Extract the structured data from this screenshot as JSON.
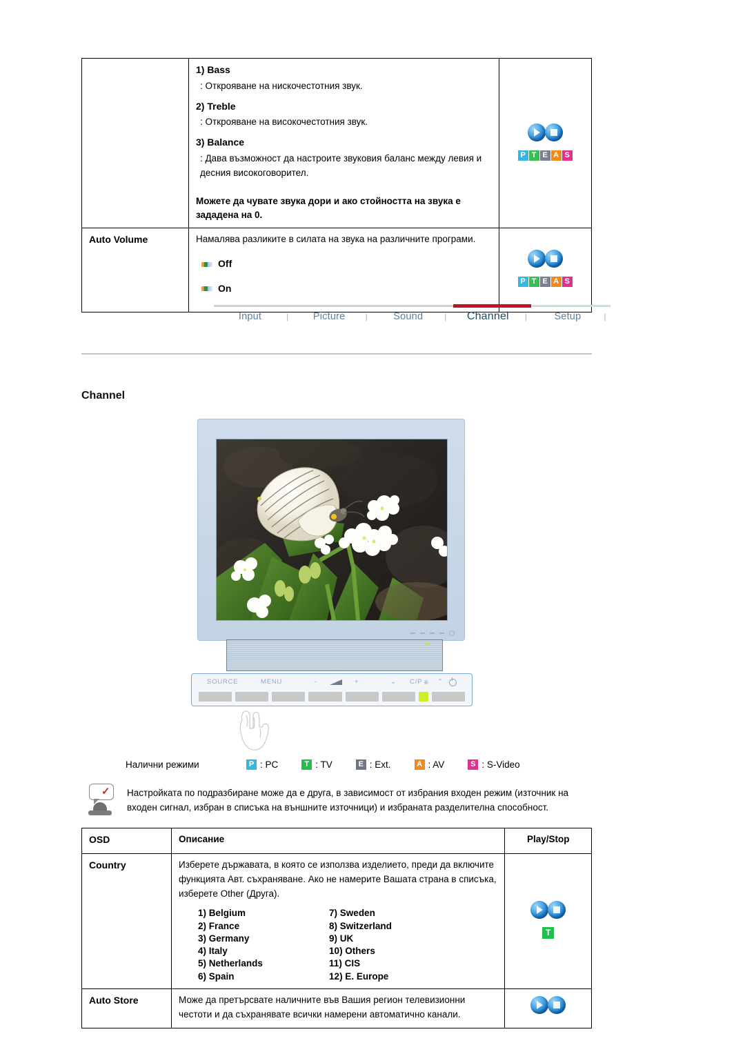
{
  "sound_table": {
    "rows": [
      {
        "osd": "",
        "items": [
          {
            "head": "1) Bass",
            "sub": ": Открояване на нискочестотния звук."
          },
          {
            "head": "2) Treble",
            "sub": ": Открояване на високочестотния звук."
          },
          {
            "head": "3) Balance",
            "sub": ": Дава възможност да настроите звуковия баланс между левия и десния високоговорител."
          }
        ],
        "note": "Можете да чувате звука дори и ако стойността на звука е зададена на 0.",
        "icon": "play-stop-pteas"
      },
      {
        "osd": "Auto Volume",
        "desc": "Намалява разликите в силата на звука на различните програми.",
        "options": [
          "Off",
          "On"
        ],
        "icon": "play-stop-pteas"
      }
    ]
  },
  "nav": {
    "tabs": [
      {
        "label": "Input",
        "active": false
      },
      {
        "label": "Picture",
        "active": false
      },
      {
        "label": "Sound",
        "active": false
      },
      {
        "label": "Channel",
        "active": true
      },
      {
        "label": "Setup",
        "active": false
      }
    ],
    "separator": "|",
    "active_bar_color": "#c01423"
  },
  "section": {
    "title": "Channel"
  },
  "monitor": {
    "buttons": [
      "SOURCE",
      "MENU",
      "-",
      "volume-icon",
      "+",
      "down-icon",
      "C/P",
      "up-icon",
      "power-icon"
    ],
    "screen_content": "butterfly-on-white-flowers-photo"
  },
  "modes": {
    "label": "Налични режими",
    "items": [
      {
        "badge": "P",
        "text": ": PC",
        "color": "#36b7e0"
      },
      {
        "badge": "T",
        "text": ": TV",
        "color": "#23bf4d"
      },
      {
        "badge": "E",
        "text": ": Ext.",
        "color": "#6e7585"
      },
      {
        "badge": "A",
        "text": ": AV",
        "color": "#f08a1c"
      },
      {
        "badge": "S",
        "text": ": S-Video",
        "color": "#e0318f"
      }
    ]
  },
  "note": {
    "text": "Настройката по подразбиране може да е друга, в зависимост от избрания входен режим (източник на входен сигнал, избран в списъка на външните източници) и избраната разделителна способност."
  },
  "channel_table": {
    "headers": [
      "OSD",
      "Описание",
      "Play/Stop"
    ],
    "rows": [
      {
        "osd": "Country",
        "desc": "Изберете държавата, в която се използва изделието, преди да включите функцията Авт. съхраняване. Ако не намерите Вашата страна в списъка, изберете Other (Друга).",
        "countries_left": [
          "1) Belgium",
          "2) France",
          "3) Germany",
          "4) Italy",
          "5) Netherlands",
          "6) Spain"
        ],
        "countries_right": [
          "7) Sweden",
          "8) Switzerland",
          "9) UK",
          "10) Others",
          "11) CIS",
          "12) E. Europe"
        ],
        "icon": "play-stop",
        "chip": "T"
      },
      {
        "osd": "Auto Store",
        "desc": "Може да претърсвате наличните във Вашия регион телевизионни честоти и да съхранявате всички намерени автоматично канали.",
        "icon": "play-stop"
      }
    ]
  },
  "pteas_badge": {
    "letters": [
      "P",
      "T",
      "E",
      "A",
      "S"
    ],
    "colors": [
      "#36b7e0",
      "#35c04f",
      "#7a7f93",
      "#f08a1c",
      "#e0318f"
    ]
  }
}
